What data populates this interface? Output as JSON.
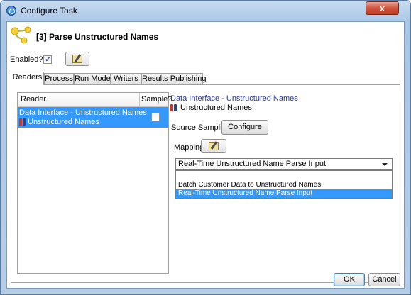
{
  "window": {
    "title": "Configure Task",
    "close_label": "x"
  },
  "task": {
    "title": "[3] Parse Unstructured Names"
  },
  "enabled": {
    "label": "Enabled?",
    "checked": true
  },
  "tabs": [
    {
      "label": "Readers",
      "active": true
    },
    {
      "label": "Process",
      "active": false
    },
    {
      "label": "Run Mode",
      "active": false
    },
    {
      "label": "Writers",
      "active": false
    },
    {
      "label": "Results Publishing",
      "active": false
    }
  ],
  "readers_table": {
    "columns": [
      "Reader",
      "Sample?"
    ],
    "rows": [
      {
        "interface": "Data Interface - Unstructured Names",
        "name": "Unstructured Names",
        "sample": false,
        "selected": true
      }
    ]
  },
  "details": {
    "interface_link": "Data Interface - Unstructured Names",
    "interface_name": "Unstructured Names",
    "source_sampling_label": "Source Sampling",
    "configure_label": "Configure",
    "mapping_label": "Mapping",
    "mapping_selected": "Real-Time Unstructured Name Parse Input",
    "mapping_options": [
      "",
      "Batch Customer Data to Unstructured Names",
      "Real-Time Unstructured Name Parse Input"
    ]
  },
  "footer": {
    "ok_label": "OK",
    "cancel_label": "Cancel"
  },
  "icons": {
    "title": "config-dialog-icon",
    "task": "task-graph-icon",
    "edit": "edit-notes-icon",
    "interface": "data-interface-icon",
    "dropdown": "chevron-down-icon"
  }
}
